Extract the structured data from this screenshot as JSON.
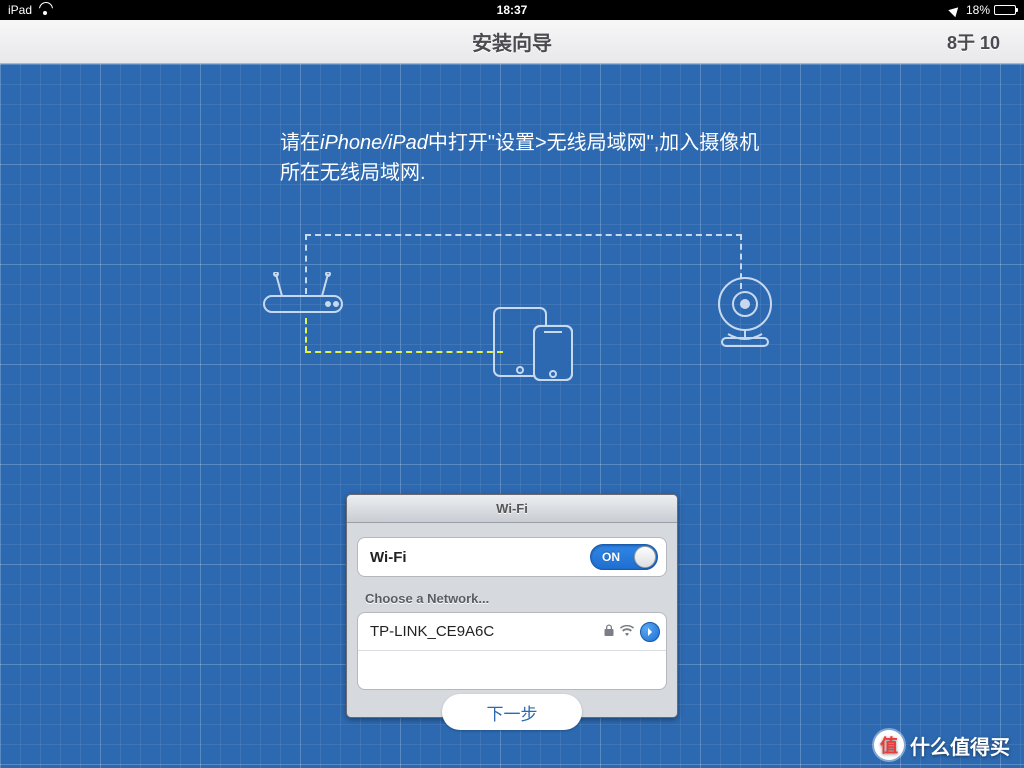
{
  "status": {
    "device": "iPad",
    "time": "18:37",
    "battery_pct": "18%"
  },
  "nav": {
    "title": "安装向导",
    "step": "8于 10"
  },
  "instruction": {
    "prefix": "请在",
    "italic": "iPhone/iPad",
    "rest": "中打开\"设置>无线局域网\",加入摄像机所在无线局域网."
  },
  "wifi_panel": {
    "title": "Wi-Fi",
    "toggle_label": "Wi-Fi",
    "toggle_state": "ON",
    "choose_label": "Choose a Network...",
    "networks": [
      {
        "ssid": "TP-LINK_CE9A6C",
        "locked": true
      }
    ]
  },
  "next_label": "下一步",
  "watermark": {
    "badge": "值",
    "text": "什么值得买"
  }
}
